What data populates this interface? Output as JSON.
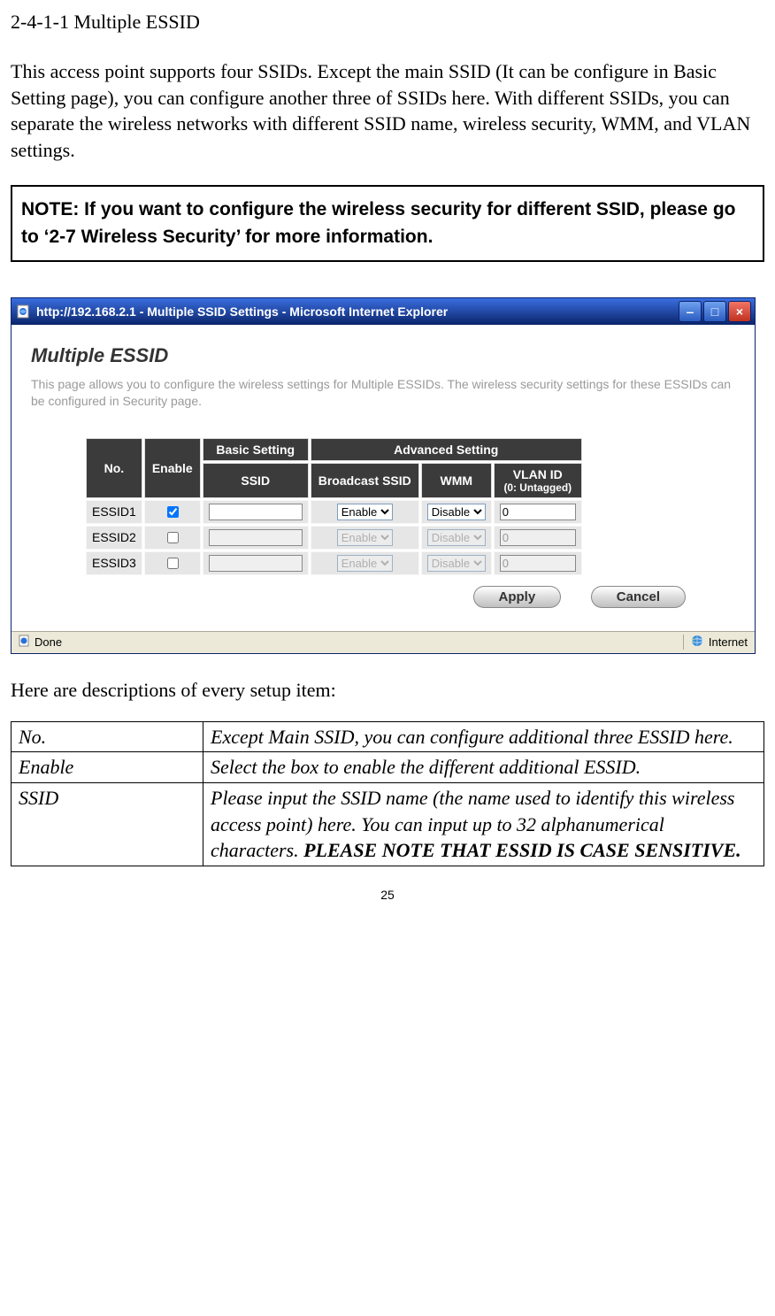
{
  "section_heading": "2-4-1-1 Multiple ESSID",
  "intro_para": "This access point supports four SSIDs. Except the main SSID (It can be configure in Basic Setting page), you can configure another three of SSIDs here. With different SSIDs, you can separate the wireless networks with different SSID name, wireless security, WMM, and VLAN settings.",
  "note_box": "NOTE: If you want to configure the wireless security for different SSID, please go to ‘2-7 Wireless Security’ for more information.",
  "ie_window": {
    "title": "http://192.168.2.1 - Multiple SSID Settings - Microsoft Internet Explorer",
    "page_heading": "Multiple ESSID",
    "page_desc": "This page allows you to configure the wireless settings for Multiple ESSIDs. The wireless security settings for these ESSIDs can be configured in Security page.",
    "headers": {
      "no": "No.",
      "enable": "Enable",
      "basic": "Basic Setting",
      "advanced": "Advanced Setting",
      "ssid": "SSID",
      "broadcast": "Broadcast SSID",
      "wmm": "WMM",
      "vlan": "VLAN ID",
      "vlan_sub": "(0: Untagged)"
    },
    "rows": [
      {
        "no": "ESSID1",
        "enable": true,
        "ssid": "",
        "broadcast": "Enable",
        "wmm": "Disable",
        "vlan": "0",
        "active": true
      },
      {
        "no": "ESSID2",
        "enable": false,
        "ssid": "",
        "broadcast": "Enable",
        "wmm": "Disable",
        "vlan": "0",
        "active": false
      },
      {
        "no": "ESSID3",
        "enable": false,
        "ssid": "",
        "broadcast": "Enable",
        "wmm": "Disable",
        "vlan": "0",
        "active": false
      }
    ],
    "apply_label": "Apply",
    "cancel_label": "Cancel",
    "status_left": "Done",
    "status_right": "Internet"
  },
  "desc_line": "Here are descriptions of every setup item:",
  "detail_table": [
    {
      "label": "No.",
      "desc": "Except Main SSID, you can configure additional three ESSID here."
    },
    {
      "label": "Enable",
      "desc": "Select the box to enable the different additional ESSID."
    },
    {
      "label": "SSID",
      "desc": "Please input the SSID name (the name used to identify this wireless access point) here. You can input up to 32 alphanumerical characters.",
      "note": "PLEASE NOTE THAT ESSID IS CASE SENSITIVE."
    }
  ],
  "page_number": "25"
}
